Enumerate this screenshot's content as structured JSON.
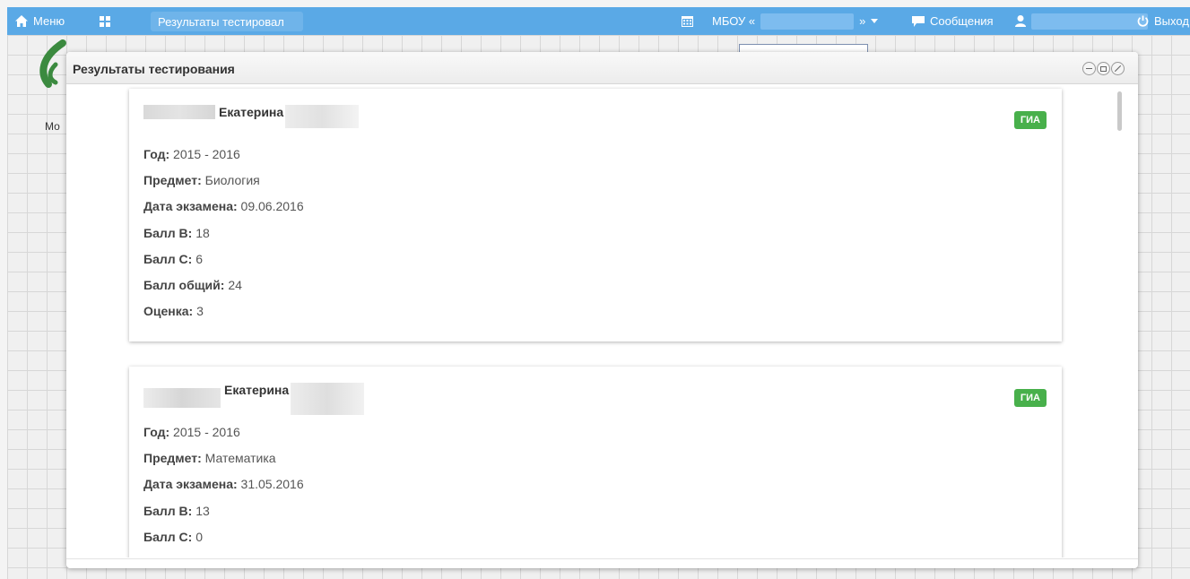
{
  "topbar": {
    "menu_label": "Меню",
    "tab_label": "Результаты тестировал",
    "org_prefix": "МБОУ «",
    "org_suffix": "»",
    "messages_label": "Сообщения",
    "exit_label": "Выход",
    "color": "#5aa9e6"
  },
  "desktop": {
    "logo_text": "Мо"
  },
  "modal": {
    "title": "Результаты тестирования"
  },
  "results": [
    {
      "name": "Екатерина",
      "badge": "ГИА",
      "year_label": "Год:",
      "year": "2015 - 2016",
      "subject_label": "Предмет:",
      "subject": "Биология",
      "date_label": "Дата экзамена:",
      "date": "09.06.2016",
      "score_b_label": "Балл В:",
      "score_b": "18",
      "score_c_label": "Балл С:",
      "score_c": "6",
      "score_total_label": "Балл общий:",
      "score_total": "24",
      "grade_label": "Оценка:",
      "grade": "3"
    },
    {
      "name": "Екатерина",
      "badge": "ГИА",
      "year_label": "Год:",
      "year": "2015 - 2016",
      "subject_label": "Предмет:",
      "subject": "Математика",
      "date_label": "Дата экзамена:",
      "date": "31.05.2016",
      "score_b_label": "Балл В:",
      "score_b": "13",
      "score_c_label": "Балл С:",
      "score_c": "0"
    }
  ],
  "icons": [
    "home-icon",
    "grid-icon",
    "calendar-icon",
    "caret-down-icon",
    "chat-icon",
    "user-icon",
    "power-icon",
    "minimize-icon",
    "maximize-icon",
    "close-icon"
  ],
  "badge_color": "#48b04b"
}
